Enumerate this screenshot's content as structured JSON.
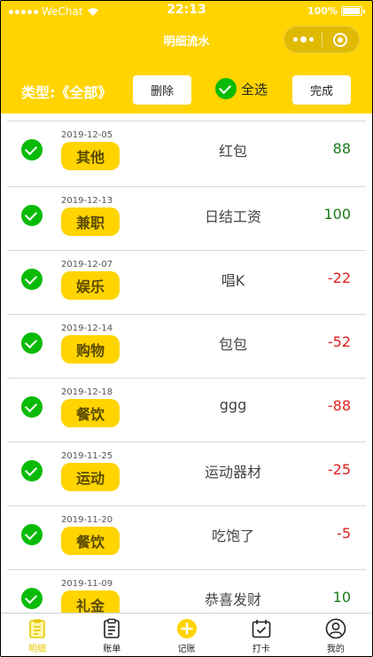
{
  "status_bar": {
    "carrier": "WeChat",
    "time": "22:13",
    "battery": "100%"
  },
  "nav": {
    "title": "明细流水"
  },
  "toolbar": {
    "type_label": "类型:《全部》",
    "delete_label": "删除",
    "select_all_label": "全选",
    "done_label": "完成"
  },
  "records": [
    {
      "date": "2019-12-05",
      "category": "其他",
      "note": "红包",
      "amount": "88",
      "sign": "pos"
    },
    {
      "date": "2019-12-13",
      "category": "兼职",
      "note": "日结工资",
      "amount": "100",
      "sign": "pos"
    },
    {
      "date": "2019-12-07",
      "category": "娱乐",
      "note": "唱K",
      "amount": "-22",
      "sign": "neg"
    },
    {
      "date": "2019-12-14",
      "category": "购物",
      "note": "包包",
      "amount": "-52",
      "sign": "neg"
    },
    {
      "date": "2019-12-18",
      "category": "餐饮",
      "note": "ggg",
      "amount": "-88",
      "sign": "neg"
    },
    {
      "date": "2019-11-25",
      "category": "运动",
      "note": "运动器材",
      "amount": "-25",
      "sign": "neg"
    },
    {
      "date": "2019-11-20",
      "category": "餐饮",
      "note": "吃饱了",
      "amount": "-5",
      "sign": "neg"
    },
    {
      "date": "2019-11-09",
      "category": "礼金",
      "note": "恭喜发财",
      "amount": "10",
      "sign": "pos"
    }
  ],
  "tabs": [
    {
      "label": "明细",
      "icon": "clipboard-icon",
      "active": true
    },
    {
      "label": "账单",
      "icon": "bill-icon",
      "active": false
    },
    {
      "label": "记账",
      "icon": "plus-circle-icon",
      "active": false
    },
    {
      "label": "打卡",
      "icon": "calendar-check-icon",
      "active": false
    },
    {
      "label": "我的",
      "icon": "user-icon",
      "active": false
    }
  ],
  "colors": {
    "accent": "#ffd400",
    "check": "#09bb07",
    "positive": "#1a7a1a",
    "negative": "#e02020"
  }
}
